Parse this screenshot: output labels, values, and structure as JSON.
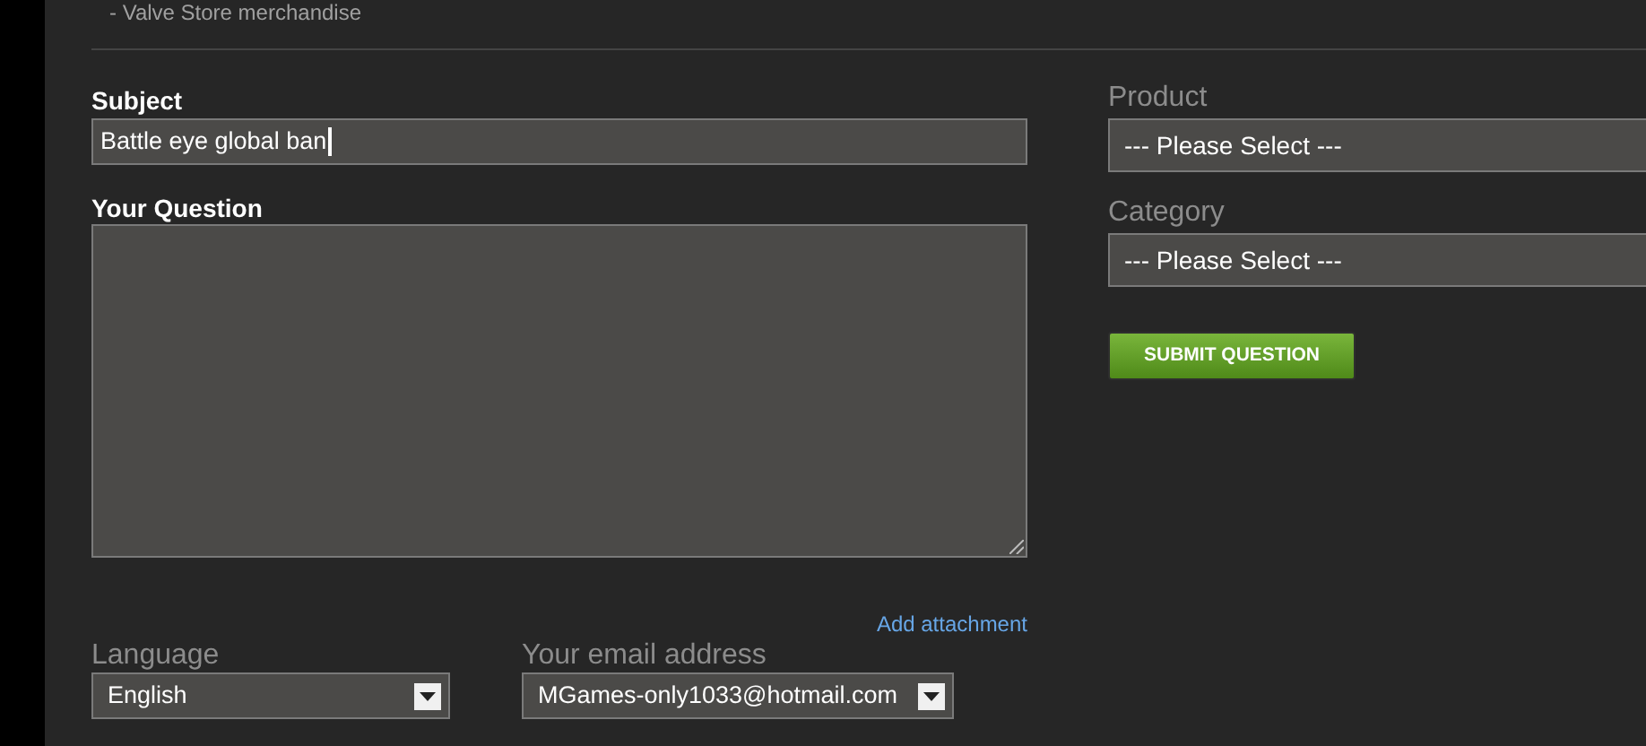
{
  "note": "- Valve Store merchandise",
  "subject": {
    "label": "Subject",
    "value": "Battle eye global ban"
  },
  "question": {
    "label": "Your Question"
  },
  "attachment_link": "Add attachment",
  "language": {
    "label": "Language",
    "value": "English"
  },
  "email": {
    "label": "Your email address",
    "value": "MGames-only1033@hotmail.com"
  },
  "product": {
    "label": "Product",
    "value": "--- Please Select ---"
  },
  "category": {
    "label": "Category",
    "value": "--- Please Select ---"
  },
  "submit_button": "SUBMIT QUESTION"
}
